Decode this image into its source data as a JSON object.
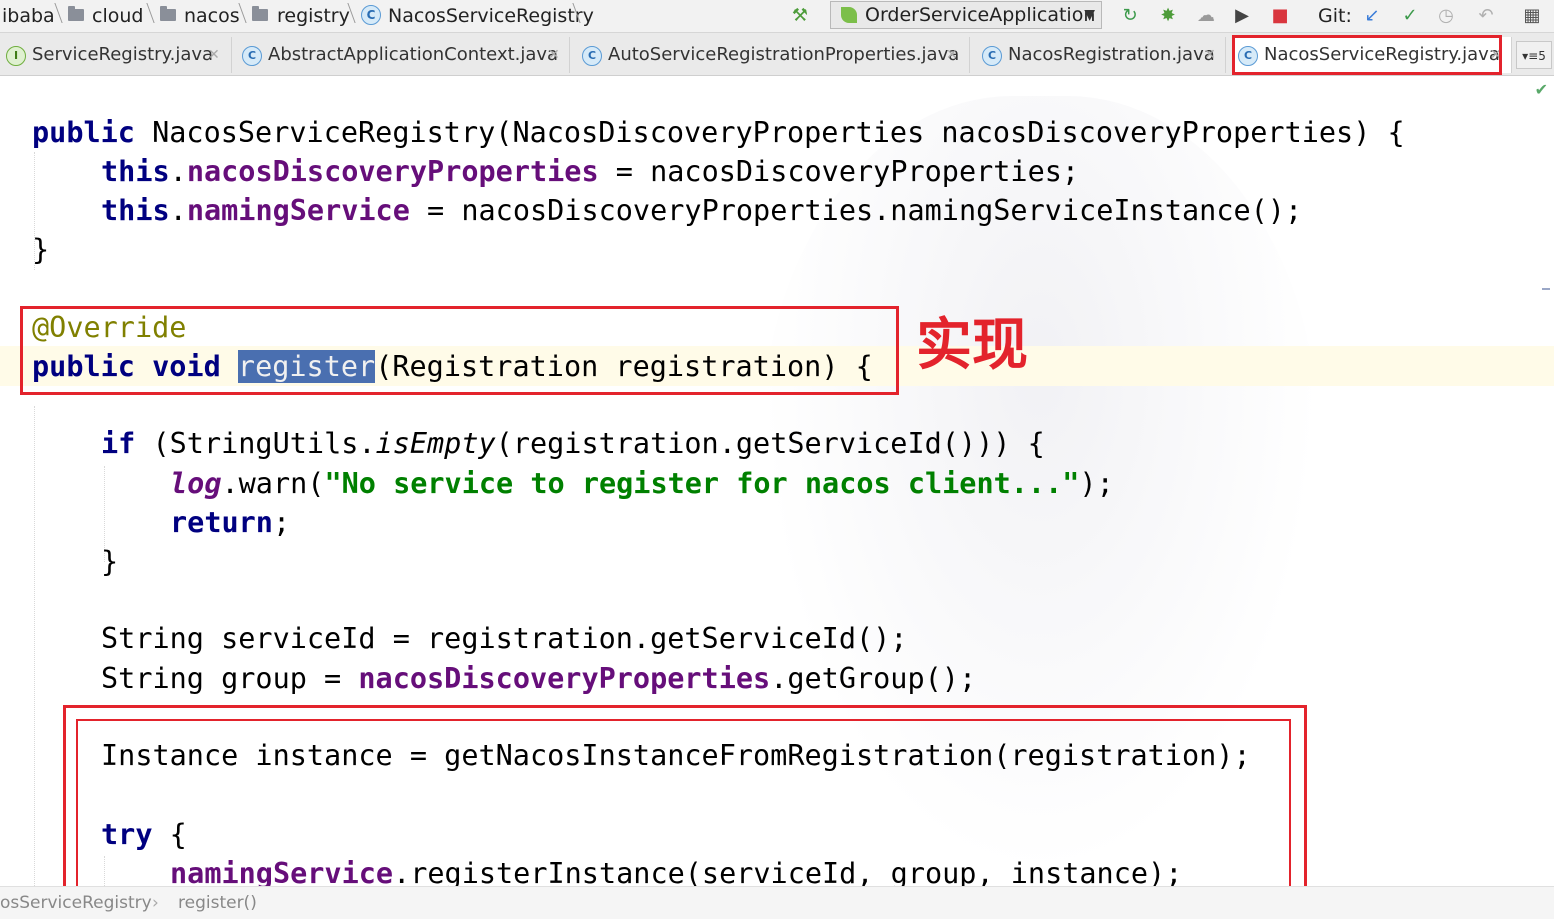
{
  "breadcrumb": {
    "items": [
      "ibaba",
      "cloud",
      "nacos",
      "registry",
      "NacosServiceRegistry"
    ]
  },
  "toolbar": {
    "run_config": "OrderServiceApplication",
    "git_label": "Git:"
  },
  "tabs": [
    {
      "label": "ServiceRegistry.java",
      "icon": "interface-icon"
    },
    {
      "label": "AbstractApplicationContext.java",
      "icon": "class-icon"
    },
    {
      "label": "AutoServiceRegistrationProperties.java",
      "icon": "class-icon"
    },
    {
      "label": "NacosRegistration.java",
      "icon": "class-icon"
    },
    {
      "label": "NacosServiceRegistry.java",
      "icon": "class-icon",
      "active": true
    }
  ],
  "tab_overflow": "5",
  "code": {
    "l1_kw": "public",
    "l1_rest": " NacosServiceRegistry(NacosDiscoveryProperties nacosDiscoveryProperties) {",
    "l2_this": "this",
    "l2_field": "nacosDiscoveryProperties",
    "l2_rest": " = nacosDiscoveryProperties;",
    "l3_this": "this",
    "l3_field": "namingService",
    "l3_rest": " = nacosDiscoveryProperties.namingServiceInstance();",
    "l4": "}",
    "l5_ann": "@Override",
    "l6_kw": "public void",
    "l6_sel": "register",
    "l6_rest": "(Registration registration) {",
    "l7_kw": "if",
    "l7_a": " (StringUtils.",
    "l7_ital": "isEmpty",
    "l7_b": "(registration.getServiceId())) {",
    "l8_log": "log",
    "l8_a": ".warn(",
    "l8_str": "\"No service to register for nacos client...\"",
    "l8_b": ");",
    "l9_kw": "return",
    "l9_rest": ";",
    "l10": "}",
    "l11": "String serviceId = registration.getServiceId();",
    "l12_a": "String group = ",
    "l12_field": "nacosDiscoveryProperties",
    "l12_b": ".getGroup();",
    "l13": "Instance instance = getNacosInstanceFromRegistration(registration);",
    "l14_kw": "try",
    "l14_rest": " {",
    "l15_field": "namingService",
    "l15_rest": ".registerInstance(serviceId, group, instance);"
  },
  "annotation_note": "实现",
  "footer": {
    "class_crumb": "osServiceRegistry",
    "method_crumb": "register()"
  },
  "colors": {
    "annotation_red": "#e3232c",
    "keyword": "#000080",
    "field": "#660e7a",
    "string": "#008000",
    "annotation": "#808000"
  }
}
